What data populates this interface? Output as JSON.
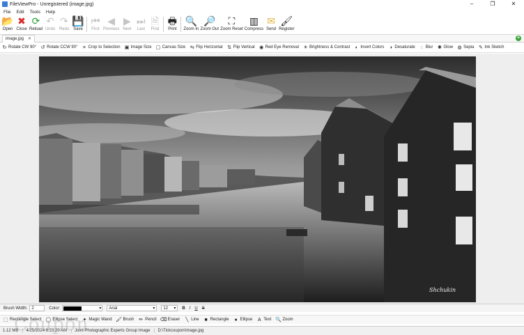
{
  "window": {
    "title": "FileViewPro - Unregistered (image.jpg)",
    "controls": [
      "–",
      "❐",
      "✕"
    ]
  },
  "menu": [
    "File",
    "Edit",
    "Tools",
    "Help"
  ],
  "toolbar": [
    {
      "label": "Open",
      "icon": "folder-icon",
      "glyph": "📂",
      "enabled": true
    },
    {
      "label": "Close",
      "icon": "close-x-icon",
      "glyph": "✖",
      "color": "#d62b2b",
      "enabled": true
    },
    {
      "label": "Reload",
      "icon": "reload-icon",
      "glyph": "⟳",
      "color": "#2e9e3a",
      "enabled": true
    },
    {
      "label": "Undo",
      "icon": "undo-icon",
      "glyph": "↶",
      "enabled": false
    },
    {
      "label": "Redo",
      "icon": "redo-icon",
      "glyph": "↷",
      "enabled": false
    },
    {
      "label": "Save",
      "icon": "save-disk-icon",
      "glyph": "💾",
      "enabled": true
    },
    {
      "label": "First",
      "icon": "first-icon",
      "glyph": "⏮",
      "enabled": false
    },
    {
      "label": "Previous",
      "icon": "previous-icon",
      "glyph": "◀",
      "enabled": false
    },
    {
      "label": "Next",
      "icon": "next-icon",
      "glyph": "▶",
      "enabled": false
    },
    {
      "label": "Last",
      "icon": "last-icon",
      "glyph": "⏭",
      "enabled": false
    },
    {
      "label": "Find",
      "icon": "find-document-icon",
      "glyph": "🗎",
      "enabled": false
    },
    {
      "label": "Print",
      "icon": "printer-icon",
      "glyph": "🖶",
      "enabled": true
    },
    {
      "label": "Zoom In",
      "icon": "zoom-in-icon",
      "glyph": "🔍",
      "enabled": true
    },
    {
      "label": "Zoom Out",
      "icon": "zoom-out-icon",
      "glyph": "🔎",
      "enabled": true
    },
    {
      "label": "Zoom Reset",
      "icon": "zoom-reset-icon",
      "glyph": "⛶",
      "enabled": true
    },
    {
      "label": "Compress",
      "icon": "compress-icon",
      "glyph": "▥",
      "enabled": true
    },
    {
      "label": "Send",
      "icon": "envelope-icon",
      "glyph": "✉",
      "color": "#e0b23a",
      "enabled": true
    },
    {
      "label": "Register",
      "icon": "paintbrush-icon",
      "glyph": "🖌",
      "enabled": true
    }
  ],
  "tabs": [
    {
      "label": "image.jpg",
      "close": "✕"
    }
  ],
  "tab_add": "+",
  "image_tools": [
    {
      "label": "Rotate CW 90°",
      "icon": "rotate-cw-icon",
      "glyph": "↻"
    },
    {
      "label": "Rotate CCW 90°",
      "icon": "rotate-ccw-icon",
      "glyph": "↺"
    },
    {
      "label": "Crop to Selection",
      "icon": "crop-icon",
      "glyph": "⌗"
    },
    {
      "label": "Image Size",
      "icon": "image-size-icon",
      "glyph": "▣"
    },
    {
      "label": "Canvas Size",
      "icon": "canvas-size-icon",
      "glyph": "▢"
    },
    {
      "label": "Flip Horizontal",
      "icon": "flip-horizontal-icon",
      "glyph": "⇆"
    },
    {
      "label": "Flip Vertical",
      "icon": "flip-vertical-icon",
      "glyph": "⇅"
    },
    {
      "label": "Red Eye Removal",
      "icon": "red-eye-icon",
      "glyph": "◉"
    },
    {
      "label": "Brightness & Contrast",
      "icon": "brightness-icon",
      "glyph": "☀"
    },
    {
      "label": "Invert Colors",
      "icon": "invert-colors-icon",
      "glyph": "◐"
    },
    {
      "label": "Desaturate",
      "icon": "desaturate-icon",
      "glyph": "◑"
    },
    {
      "label": "Blur",
      "icon": "blur-icon",
      "glyph": "◌"
    },
    {
      "label": "Glow",
      "icon": "glow-icon",
      "glyph": "✺"
    },
    {
      "label": "Sepia",
      "icon": "sepia-icon",
      "glyph": "◍"
    },
    {
      "label": "Ink Sketch",
      "icon": "ink-sketch-icon",
      "glyph": "✎"
    }
  ],
  "photo": {
    "signature": "Shchukin"
  },
  "brush_bar": {
    "brush_width_label": "Brush Width:",
    "brush_width_value": "2",
    "color_label": "Color:",
    "color_value": "#000000",
    "font_value": "Arial",
    "font_size_value": "12",
    "bold": "B",
    "italic": "I",
    "underline": "U",
    "strike": "S"
  },
  "draw_tools": [
    {
      "label": "Rectangle Select",
      "icon": "rectangle-select-icon",
      "glyph": "⬚"
    },
    {
      "label": "Ellipse Select",
      "icon": "ellipse-select-icon",
      "glyph": "◯"
    },
    {
      "label": "Magic Wand",
      "icon": "magic-wand-icon",
      "glyph": "✦"
    },
    {
      "label": "Brush",
      "icon": "brush-icon",
      "glyph": "🖌"
    },
    {
      "label": "Pencil",
      "icon": "pencil-icon",
      "glyph": "✏"
    },
    {
      "label": "Eraser",
      "icon": "eraser-icon",
      "glyph": "⌫"
    },
    {
      "label": "Line",
      "icon": "line-icon",
      "glyph": "╲"
    },
    {
      "label": "Rectangle",
      "icon": "rectangle-icon",
      "glyph": "■"
    },
    {
      "label": "Ellipse",
      "icon": "ellipse-icon",
      "glyph": "●"
    },
    {
      "label": "Text",
      "icon": "text-icon",
      "glyph": "A"
    },
    {
      "label": "Zoom",
      "icon": "zoom-tool-icon",
      "glyph": "🔍"
    }
  ],
  "status": {
    "size": "1.12 MB",
    "date": "4/25/2024 8:23:20 AM",
    "type": "Joint Photographic Experts Group Image",
    "path": "D:\\Tickcoupon\\image.jpg"
  },
  "watermark": "Coupon"
}
